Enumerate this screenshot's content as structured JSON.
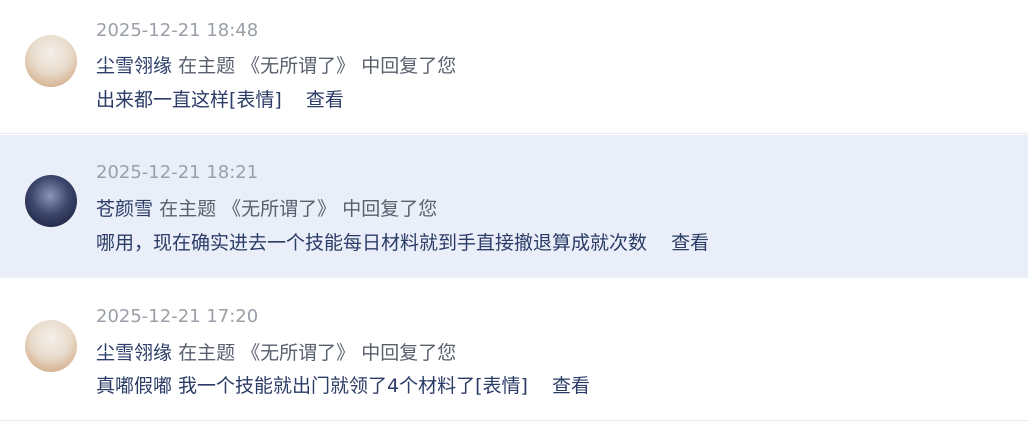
{
  "notifications": [
    {
      "time": "2025-12-21 18:48",
      "username": "尘雪翎缘",
      "in_topic": "在主题",
      "topic": "《无所谓了》",
      "reply_text": "中回复了您",
      "content": "出来都一直这样[表情]",
      "view": "查看",
      "avatar": "anime-avatar-light"
    },
    {
      "time": "2025-12-21 18:21",
      "username": "苍颜雪",
      "in_topic": "在主题",
      "topic": "《无所谓了》",
      "reply_text": "中回复了您",
      "content": "哪用，现在确实进去一个技能每日材料就到手直接撤退算成就次数",
      "view": "查看",
      "avatar": "anime-avatar-dark"
    },
    {
      "time": "2025-12-21 17:20",
      "username": "尘雪翎缘",
      "in_topic": "在主题",
      "topic": "《无所谓了》",
      "reply_text": "中回复了您",
      "content": "真嘟假嘟 我一个技能就出门就领了4个材料了[表情]",
      "view": "查看",
      "avatar": "anime-avatar-light"
    }
  ],
  "colors": {
    "highlight_bg": "#eaeef9",
    "primary_text": "#2b3c67",
    "time_text": "#9aa0a8",
    "muted_text": "#59606d"
  }
}
